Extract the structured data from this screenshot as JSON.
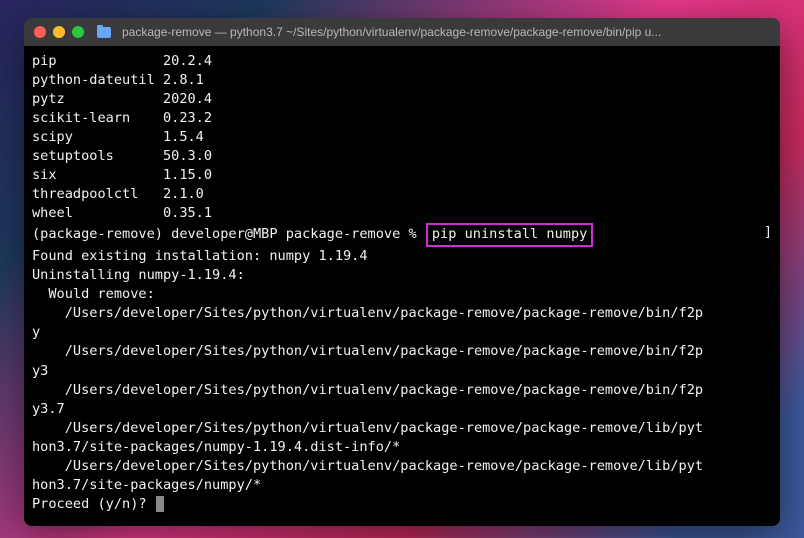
{
  "window": {
    "title": "package-remove — python3.7 ~/Sites/python/virtualenv/package-remove/package-remove/bin/pip u..."
  },
  "packages": [
    {
      "name": "pip",
      "version": "20.2.4"
    },
    {
      "name": "python-dateutil",
      "version": "2.8.1"
    },
    {
      "name": "pytz",
      "version": "2020.4"
    },
    {
      "name": "scikit-learn",
      "version": "0.23.2"
    },
    {
      "name": "scipy",
      "version": "1.5.4"
    },
    {
      "name": "setuptools",
      "version": "50.3.0"
    },
    {
      "name": "six",
      "version": "1.15.0"
    },
    {
      "name": "threadpoolctl",
      "version": "2.1.0"
    },
    {
      "name": "wheel",
      "version": "0.35.1"
    }
  ],
  "prompt": {
    "prefix": "(package-remove) developer@MBP package-remove %",
    "command": "pip uninstall numpy"
  },
  "output": {
    "found": "Found existing installation: numpy 1.19.4",
    "uninstalling": "Uninstalling numpy-1.19.4:",
    "would_remove": "  Would remove:",
    "paths": [
      "    /Users/developer/Sites/python/virtualenv/package-remove/package-remove/bin/f2py",
      "    /Users/developer/Sites/python/virtualenv/package-remove/package-remove/bin/f2py3",
      "    /Users/developer/Sites/python/virtualenv/package-remove/package-remove/bin/f2py3.7",
      "    /Users/developer/Sites/python/virtualenv/package-remove/package-remove/lib/python3.7/site-packages/numpy-1.19.4.dist-info/*",
      "    /Users/developer/Sites/python/virtualenv/package-remove/package-remove/lib/python3.7/site-packages/numpy/*"
    ],
    "proceed": "Proceed (y/n)? "
  }
}
